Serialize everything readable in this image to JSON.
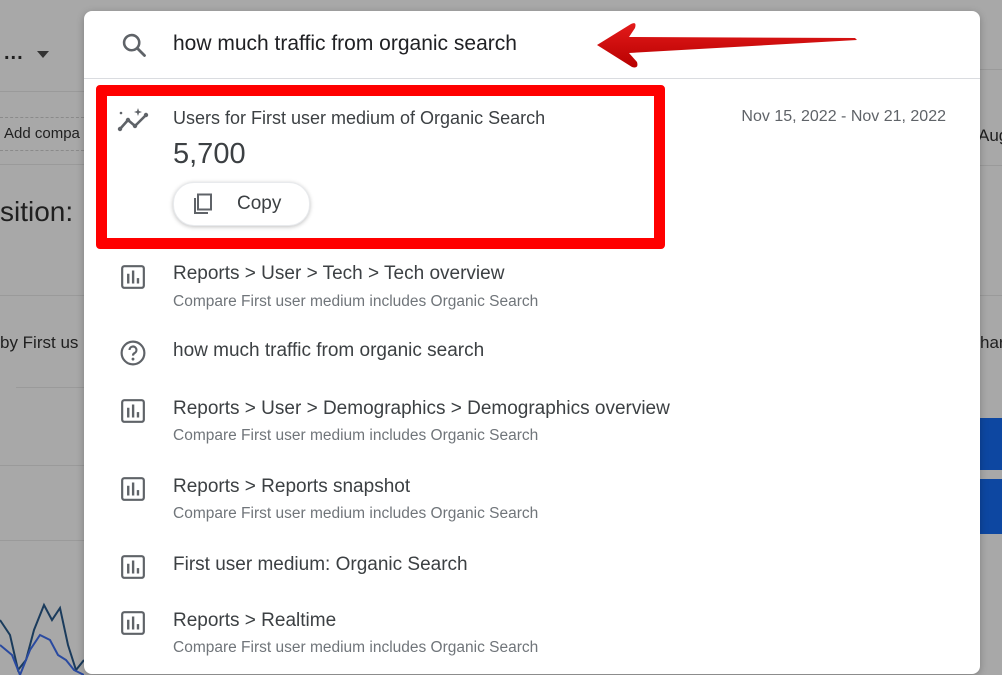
{
  "background": {
    "top_left_ellipsis": "...",
    "add_comparison": "Add compa",
    "partial_heading": "sition:",
    "partial_label": "by First us",
    "right_partial_date": "Aug",
    "right_partial_text": "har"
  },
  "search": {
    "query": "how much traffic from organic search",
    "icon": "search-icon"
  },
  "insight": {
    "icon": "insights-icon",
    "title": "Users for First user medium of Organic Search",
    "date_range": "Nov 15, 2022 - Nov 21, 2022",
    "value": "5,700",
    "copy_label": "Copy",
    "copy_icon": "copy-icon"
  },
  "results": [
    {
      "icon": "report-chart-icon",
      "title": "Reports > User > Tech > Tech overview",
      "subtitle": "Compare First user medium includes Organic Search"
    },
    {
      "icon": "help-circle-icon",
      "title": "how much traffic from organic search",
      "subtitle": ""
    },
    {
      "icon": "report-chart-icon",
      "title": "Reports > User > Demographics > Demographics overview",
      "subtitle": "Compare First user medium includes Organic Search"
    },
    {
      "icon": "report-chart-icon",
      "title": "Reports > Reports snapshot",
      "subtitle": "Compare First user medium includes Organic Search"
    },
    {
      "icon": "report-chart-icon",
      "title": "First user medium: Organic Search",
      "subtitle": ""
    },
    {
      "icon": "report-chart-icon",
      "title": "Reports > Realtime",
      "subtitle": "Compare First user medium includes Organic Search"
    }
  ],
  "annotation": {
    "highlight_color": "#ff0000",
    "arrow_color": "#d90000"
  }
}
